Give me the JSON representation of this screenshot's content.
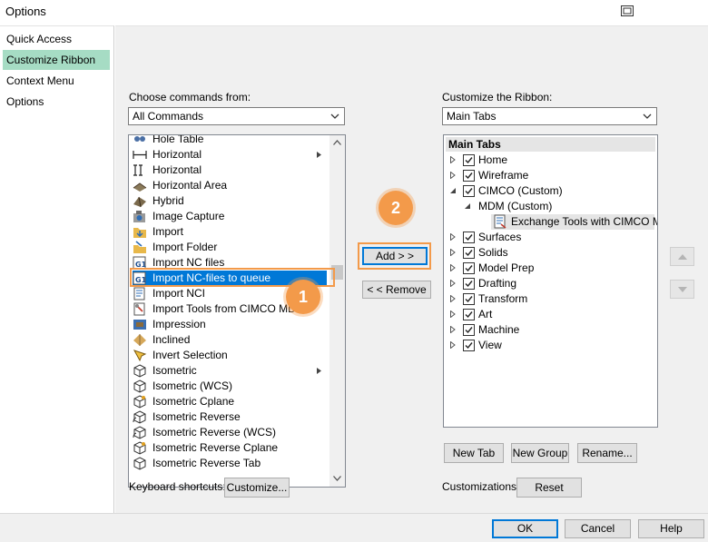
{
  "window": {
    "title": "Options"
  },
  "sidebar": {
    "items": [
      {
        "label": "Quick Access Toolbar",
        "selected": false
      },
      {
        "label": "Customize Ribbon",
        "selected": true
      },
      {
        "label": "Context Menu",
        "selected": false
      },
      {
        "label": "Options",
        "selected": false
      }
    ]
  },
  "left_panel": {
    "choose_label": "Choose commands from:",
    "choose_value": "All Commands",
    "commands": [
      {
        "label": "Hole Table",
        "icon": "hole-table-icon"
      },
      {
        "label": "Horizontal",
        "icon": "horizontal-dimension-icon",
        "submenu": true
      },
      {
        "label": "Horizontal",
        "icon": "horizontal-icon"
      },
      {
        "label": "Horizontal Area",
        "icon": "horizontal-area-icon"
      },
      {
        "label": "Hybrid",
        "icon": "hybrid-icon"
      },
      {
        "label": "Image Capture",
        "icon": "image-capture-icon"
      },
      {
        "label": "Import",
        "icon": "import-icon"
      },
      {
        "label": "Import Folder",
        "icon": "import-folder-icon"
      },
      {
        "label": "Import NC files",
        "icon": "import-nc-files-icon"
      },
      {
        "label": "Import NC-files to queue",
        "icon": "import-nc-queue-icon",
        "selected": true
      },
      {
        "label": "Import NCI",
        "icon": "import-nci-icon"
      },
      {
        "label": "Import Tools from CIMCO MDM",
        "icon": "import-tools-icon"
      },
      {
        "label": "Impression",
        "icon": "impression-icon"
      },
      {
        "label": "Inclined",
        "icon": "inclined-icon"
      },
      {
        "label": "Invert Selection",
        "icon": "invert-selection-icon"
      },
      {
        "label": "Isometric",
        "icon": "isometric-icon",
        "submenu": true
      },
      {
        "label": "Isometric (WCS)",
        "icon": "isometric-wcs-icon"
      },
      {
        "label": "Isometric Cplane",
        "icon": "isometric-cplane-icon"
      },
      {
        "label": "Isometric Reverse",
        "icon": "isometric-reverse-icon"
      },
      {
        "label": "Isometric Reverse (WCS)",
        "icon": "isometric-reverse-wcs-icon"
      },
      {
        "label": "Isometric Reverse Cplane",
        "icon": "isometric-reverse-cplane-icon"
      },
      {
        "label": "Isometric Reverse Tab",
        "icon": "isometric-reverse-tab-icon"
      }
    ],
    "keyboard_label": "Keyboard shortcuts:",
    "customize_button": "Customize..."
  },
  "middle": {
    "add_button": "Add > >",
    "remove_button": "< < Remove"
  },
  "right_panel": {
    "ribbon_label": "Customize the Ribbon:",
    "ribbon_value": "Main Tabs",
    "tree_header": "Main Tabs",
    "tree": [
      {
        "label": "Home",
        "level": 0,
        "expander": "collapsed",
        "checked": true
      },
      {
        "label": "Wireframe",
        "level": 0,
        "expander": "collapsed",
        "checked": true
      },
      {
        "label": "CIMCO (Custom)",
        "level": 0,
        "expander": "expanded",
        "checked": true
      },
      {
        "label": "MDM (Custom)",
        "level": 1,
        "expander": "expanded",
        "checked": null
      },
      {
        "label": "Exchange Tools with CIMCO MDM",
        "level": 2,
        "expander": "none",
        "checked": null,
        "icon": "exchange-tools-icon"
      },
      {
        "label": "Surfaces",
        "level": 0,
        "expander": "collapsed",
        "checked": true
      },
      {
        "label": "Solids",
        "level": 0,
        "expander": "collapsed",
        "checked": true
      },
      {
        "label": "Model Prep",
        "level": 0,
        "expander": "collapsed",
        "checked": true
      },
      {
        "label": "Drafting",
        "level": 0,
        "expander": "collapsed",
        "checked": true
      },
      {
        "label": "Transform",
        "level": 0,
        "expander": "collapsed",
        "checked": true
      },
      {
        "label": "Art",
        "level": 0,
        "expander": "collapsed",
        "checked": true
      },
      {
        "label": "Machine",
        "level": 0,
        "expander": "collapsed",
        "checked": true
      },
      {
        "label": "View",
        "level": 0,
        "expander": "collapsed",
        "checked": true
      }
    ],
    "new_tab_button": "New Tab",
    "new_group_button": "New Group",
    "rename_button": "Rename...",
    "customizations_label": "Customizations:",
    "reset_button": "Reset"
  },
  "annotations": {
    "step1": "1",
    "step2": "2"
  },
  "footer": {
    "ok": "OK",
    "cancel": "Cancel",
    "help": "Help"
  },
  "colors": {
    "accent": "#0078d7",
    "nav_selected": "#a6dcc4",
    "annotation": "#f39a4a"
  }
}
